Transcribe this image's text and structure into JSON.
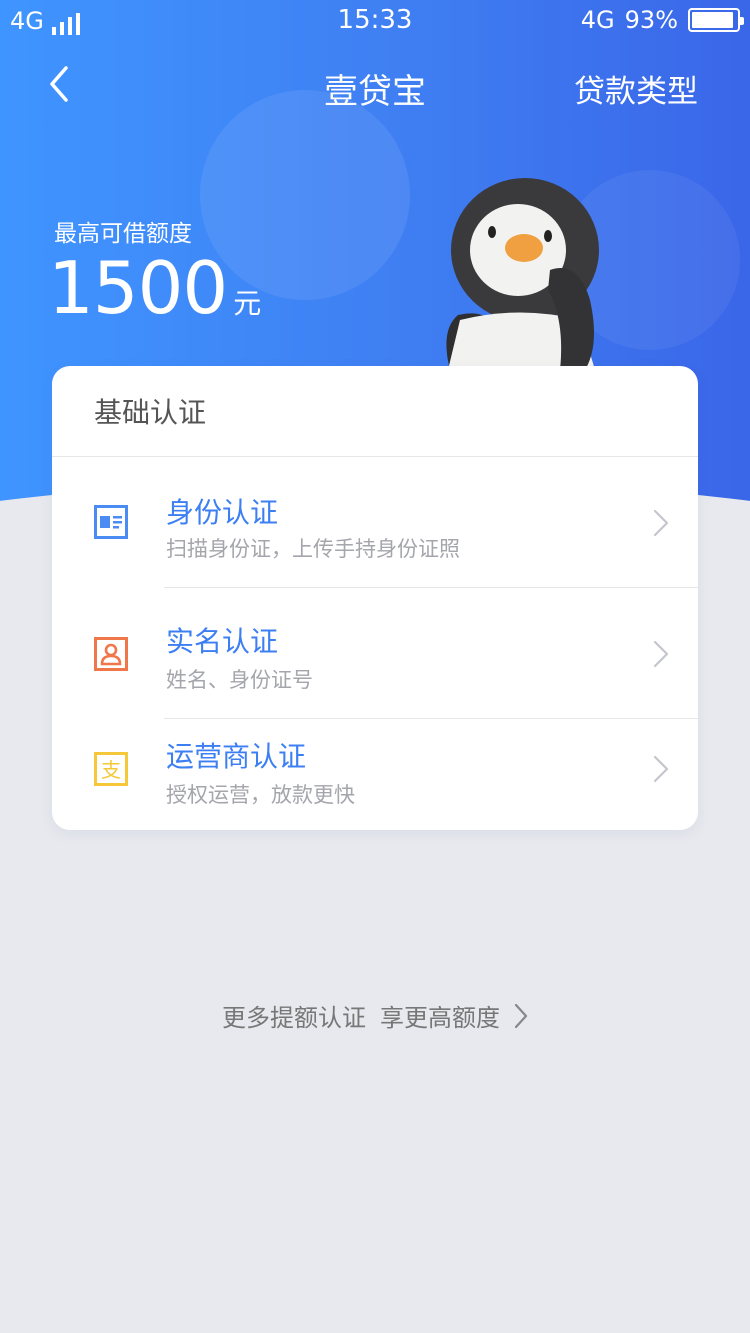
{
  "status_bar": {
    "network_left": "4G",
    "time": "15:33",
    "network_right": "4G",
    "battery": "93%"
  },
  "navbar": {
    "back_icon": "chevron-left-icon",
    "title": "壹贷宝",
    "right_label": "贷款类型"
  },
  "hero": {
    "amount_label": "最高可借额度",
    "amount": "1500",
    "unit": "元"
  },
  "card": {
    "title": "基础认证",
    "items": [
      {
        "title": "身份认证",
        "subtitle": "扫描身份证，上传手持身份证照",
        "icon": "id-card-icon",
        "color": "#4a8cf4"
      },
      {
        "title": "实名认证",
        "subtitle": "姓名、身份证号",
        "icon": "person-icon",
        "color": "#f0774a"
      },
      {
        "title": "运营商认证",
        "subtitle": "授权运营，放款更快",
        "icon": "alipay-icon",
        "color": "#f5c83a"
      }
    ]
  },
  "footer_link": {
    "label": "更多提额认证",
    "label2": "享更高额度"
  },
  "colors": {
    "primary": "#3f7ef2",
    "item_title": "#3c7ff2",
    "background": "#e8e9ee"
  }
}
